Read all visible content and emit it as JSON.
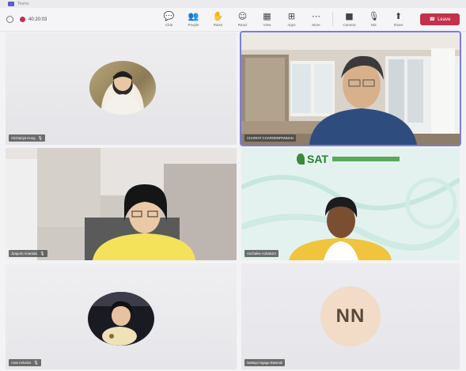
{
  "window": {
    "title": "Teams"
  },
  "toolbar": {
    "timer": "40:20:03",
    "tools": [
      {
        "label": "Chat",
        "icon": "chat-icon",
        "glyph": "💬"
      },
      {
        "label": "People",
        "icon": "people-icon",
        "glyph": "👥"
      },
      {
        "label": "Raise",
        "icon": "raise-hand-icon",
        "glyph": "✋"
      },
      {
        "label": "React",
        "icon": "react-icon",
        "glyph": "☺"
      },
      {
        "label": "View",
        "icon": "view-icon",
        "glyph": "▦"
      },
      {
        "label": "Apps",
        "icon": "apps-icon",
        "glyph": "⊞"
      },
      {
        "label": "More",
        "icon": "more-icon",
        "glyph": "⋯"
      }
    ],
    "media": [
      {
        "label": "Camera",
        "icon": "camera-icon",
        "glyph": "■"
      },
      {
        "label": "Mic",
        "icon": "mic-icon",
        "glyph": "🎙"
      },
      {
        "label": "Share",
        "icon": "share-icon",
        "glyph": "⬆"
      }
    ],
    "leave_label": "Leave",
    "accent": "#c4314b"
  },
  "participants": [
    {
      "name": "Ahchariya Hong",
      "initials": "",
      "video": "avatar-photo",
      "active": false
    },
    {
      "name": "CHAIRAT CHAROENPANNAN",
      "initials": "",
      "video": "camera",
      "active": true
    },
    {
      "name": "Jiraporn Anantasi",
      "initials": "",
      "video": "camera",
      "active": false
    },
    {
      "name": "Anchalee Achakorn",
      "initials": "",
      "video": "camera",
      "active": false
    },
    {
      "name": "Aran Ankalus",
      "initials": "",
      "video": "avatar-photo",
      "active": false
    },
    {
      "name": "Nattaya Ngaga Bawnuk",
      "initials": "NN",
      "video": "initials",
      "active": false
    }
  ]
}
